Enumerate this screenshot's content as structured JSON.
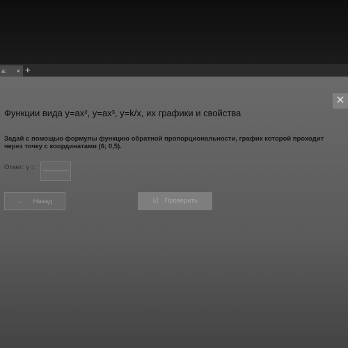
{
  "browser": {
    "tab_label": "а:",
    "tab_close": "×",
    "new_tab": "+"
  },
  "page": {
    "title": "Функции вида y=ax², y=ax³, y=k/x, их графики и свойства",
    "task_text": "Задай с помощью формулы функцию обратной пропорциональности, график которой проходит через точку с координатами (6; 0,5).",
    "answer_label": "Ответ: y =",
    "answer_value": "",
    "back_label": "Назад",
    "check_label": "Проверить"
  },
  "icons": {
    "back_arrow": "arrow-left-icon",
    "check": "checkbox-icon",
    "expand": "expand-icon"
  }
}
